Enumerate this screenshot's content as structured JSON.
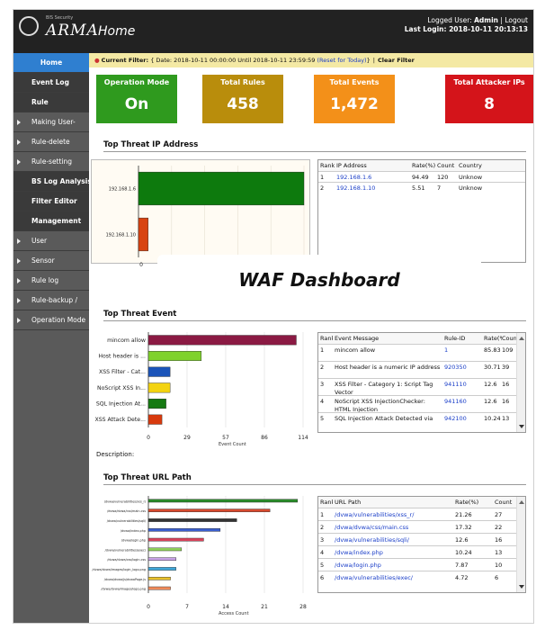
{
  "app": {
    "logo_small": "BIS Security",
    "logo": "ARMA",
    "title": "Home",
    "login_line1_prefix": "Logged User: ",
    "user": "Admin",
    "login_sep": " | ",
    "logout": "Logout",
    "login_line2_prefix": "Last Login: ",
    "last_login": "2018-10-11 20:13:13"
  },
  "sidebar": [
    "Home",
    "Event Log",
    "Rule",
    "Making User-",
    "Rule-delete",
    "Rule-setting",
    "BS Log Analysis",
    "Filter Editor",
    "Management",
    "User",
    "Sensor",
    "Rule log",
    "Rule-backup /",
    "Operation Mode"
  ],
  "filter": {
    "label": "Current Filter:",
    "text": "{ Date: 2018-10-11 00:00:00 Until 2018-10-11 23:59:59 ",
    "reset": "(Reset for Today)",
    "close": "}",
    "clear": "Clear Filter"
  },
  "cards": [
    {
      "title": "Operation Mode",
      "value": "On",
      "color": "#2f9a1e"
    },
    {
      "title": "Total Rules",
      "value": "458",
      "color": "#b98d0c"
    },
    {
      "title": "Total Events",
      "value": "1,472",
      "color": "#f39019"
    },
    {
      "title": "Total Attacker IPs",
      "value": "8",
      "color": "#d4141a"
    }
  ],
  "sections": {
    "ip": "Top Threat IP Address",
    "event": "Top Threat Event",
    "url": "Top Threat URL Path"
  },
  "overlay": "WAF Dashboard",
  "description_label": "Description:",
  "ip_table": {
    "headers": [
      "Rank",
      "IP Address",
      "Rate(%)",
      "Count",
      "Country"
    ],
    "rows": [
      [
        "1",
        "192.168.1.6",
        "94.49",
        "120",
        "Unknow"
      ],
      [
        "2",
        "192.168.1.10",
        "5.51",
        "7",
        "Unknow"
      ]
    ]
  },
  "event_table": {
    "headers": [
      "Rank",
      "Event Message",
      "Rule-ID",
      "Rate(%)",
      "Count"
    ],
    "rows": [
      [
        "1",
        "mincom allow",
        "1",
        "85.83",
        "109"
      ],
      [
        "2",
        "Host header is a numeric IP address",
        "920350",
        "30.71",
        "39"
      ],
      [
        "3",
        "XSS Filter - Category 1: Script Tag Vector",
        "941110",
        "12.6",
        "16"
      ],
      [
        "4",
        "NoScript XSS InjectionChecker: HTML Injection",
        "941160",
        "12.6",
        "16"
      ],
      [
        "5",
        "SQL Injection Attack Detected via",
        "942100",
        "10.24",
        "13"
      ]
    ]
  },
  "url_table": {
    "headers": [
      "Rank",
      "URL Path",
      "Rate(%)",
      "Count"
    ],
    "rows": [
      [
        "1",
        "/dvwa/vulnerabilities/xss_r/",
        "21.26",
        "27"
      ],
      [
        "2",
        "/dvwa/dvwa/css/main.css",
        "17.32",
        "22"
      ],
      [
        "3",
        "/dvwa/vulnerabilities/sqli/",
        "12.6",
        "16"
      ],
      [
        "4",
        "/dvwa/index.php",
        "10.24",
        "13"
      ],
      [
        "5",
        "/dvwa/login.php",
        "7.87",
        "10"
      ],
      [
        "6",
        "/dvwa/vulnerabilities/exec/",
        "4.72",
        "6"
      ]
    ]
  },
  "chart_data": [
    {
      "type": "bar",
      "orientation": "horizontal",
      "categories": [
        "192.168.1.6",
        "192.168.1.10"
      ],
      "values": [
        120,
        7
      ],
      "colors": [
        "#0d7a0d",
        "#d84312"
      ],
      "x_ticks": [
        "0"
      ]
    },
    {
      "type": "bar",
      "orientation": "horizontal",
      "categories": [
        "mincom allow",
        "Host header is ...",
        "XSS Filter - Cat...",
        "NoScript XSS In...",
        "SQL Injection At...",
        "XSS Attack Dete..."
      ],
      "values": [
        109,
        39,
        16,
        16,
        13,
        10
      ],
      "colors": [
        "#8b1a43",
        "#7fd22c",
        "#1b54b9",
        "#f3d311",
        "#167a12",
        "#d83a0e"
      ],
      "xlim": [
        0,
        114
      ],
      "x_ticks": [
        "0",
        "29",
        "57",
        "86",
        "114"
      ],
      "xlabel": "Event Count"
    },
    {
      "type": "bar",
      "orientation": "horizontal",
      "categories": [
        "/dvwa/vulnerabilities/xss_r/",
        "/dvwa/dvwa/css/main.css",
        "/dvwa/vulnerabilities/sqli/",
        "/dvwa/index.php",
        "/dvwa/login.php",
        "/dvwa/vulnerabilities/exec/",
        "/dvwa/dvwa/css/login.css",
        "/dvwa/dvwa/images/login_logo.png",
        "/dvwa/dvwa/js/dvwaPage.js",
        "/dvwa/dvwa/images/logo.png"
      ],
      "values": [
        27,
        22,
        16,
        13,
        10,
        6,
        5,
        5,
        4,
        4
      ],
      "colors": [
        "#2a8a2a",
        "#d74a2e",
        "#333333",
        "#3a5fcf",
        "#d7435a",
        "#8fcf5a",
        "#c8a2e6",
        "#3fa7d9",
        "#e8c02a",
        "#ee8a5a"
      ],
      "xlim": [
        0,
        28
      ],
      "x_ticks": [
        "0",
        "7",
        "14",
        "21",
        "28"
      ],
      "xlabel": "Access Count"
    }
  ]
}
